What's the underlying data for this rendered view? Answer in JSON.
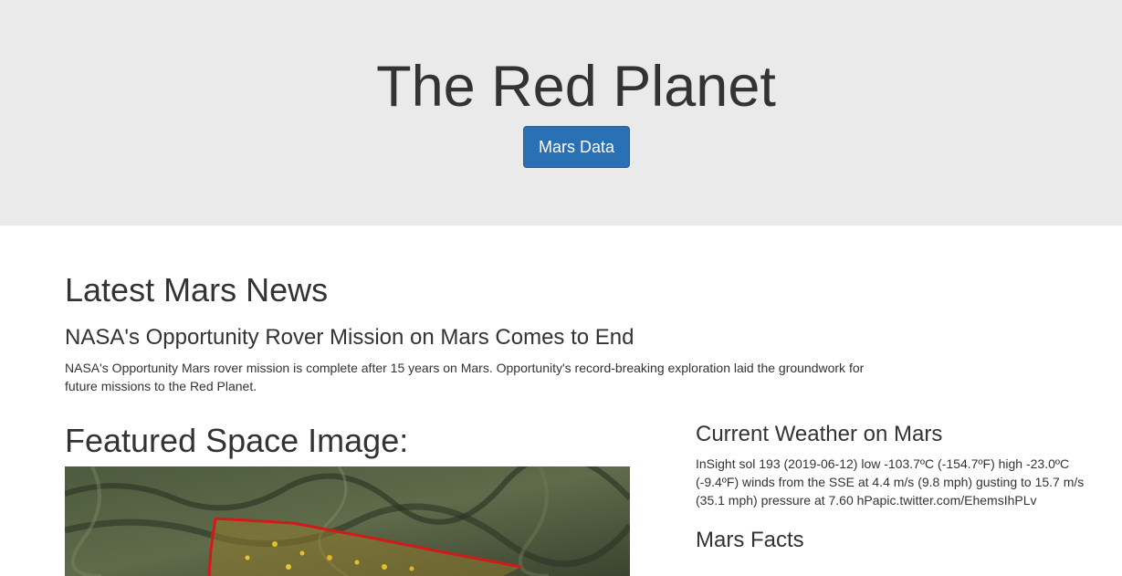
{
  "header": {
    "title": "The Red Planet",
    "button_label": "Mars Data"
  },
  "news": {
    "heading": "Latest Mars News",
    "title": "NASA's Opportunity Rover Mission on Mars Comes to End",
    "paragraph": "NASA's Opportunity Mars rover mission is complete after 15 years on Mars. Opportunity's record-breaking exploration laid the groundwork for future missions to the Red Planet."
  },
  "featured": {
    "heading": "Featured Space Image:"
  },
  "weather": {
    "heading": "Current Weather on Mars",
    "text": "InSight sol 193 (2019-06-12) low -103.7ºC (-154.7ºF) high -23.0ºC (-9.4ºF) winds from the SSE at 4.4 m/s (9.8 mph) gusting to 15.7 m/s (35.1 mph) pressure at 7.60 hPapic.twitter.com/EhemsIhPLv"
  },
  "facts": {
    "heading": "Mars Facts"
  },
  "colors": {
    "jumbotron_bg": "#eaeaea",
    "button_bg": "#2a70b5",
    "text": "#333333"
  }
}
